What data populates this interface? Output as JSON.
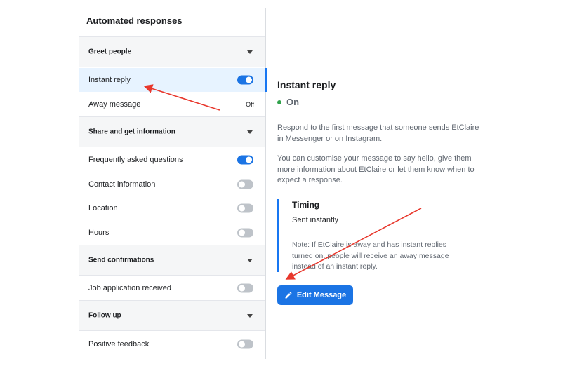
{
  "sidebar": {
    "title": "Automated responses",
    "sections": [
      {
        "header": "Greet people",
        "items": [
          {
            "label": "Instant reply",
            "state": "on",
            "selected": true
          },
          {
            "label": "Away message",
            "state_text": "Off"
          }
        ]
      },
      {
        "header": "Share and get information",
        "items": [
          {
            "label": "Frequently asked questions",
            "state": "on"
          },
          {
            "label": "Contact information",
            "state": "off"
          },
          {
            "label": "Location",
            "state": "off"
          },
          {
            "label": "Hours",
            "state": "off"
          }
        ]
      },
      {
        "header": "Send confirmations",
        "items": [
          {
            "label": "Job application received",
            "state": "off"
          }
        ]
      },
      {
        "header": "Follow up",
        "items": [
          {
            "label": "Positive feedback",
            "state": "off"
          }
        ]
      }
    ]
  },
  "detail": {
    "title": "Instant reply",
    "status": "On",
    "description_1": "Respond to the first message that someone sends EtClaire in Messenger or on Instagram.",
    "description_2": "You can customise your message to say hello, give them more information about EtClaire or let them know when to expect a response.",
    "timing": {
      "heading": "Timing",
      "value": "Sent instantly",
      "note": "Note: If EtClaire is away and has instant replies turned on, people will receive an away message instead of an instant reply."
    },
    "edit_button_label": "Edit Message"
  },
  "colors": {
    "accent": "#1b74e4",
    "selected_bg": "#e7f3ff",
    "status_green": "#31a24c",
    "annotation_arrow": "#e8372c"
  },
  "icons": {
    "edit": "pencil-icon",
    "section_toggle": "caret-down-icon"
  }
}
